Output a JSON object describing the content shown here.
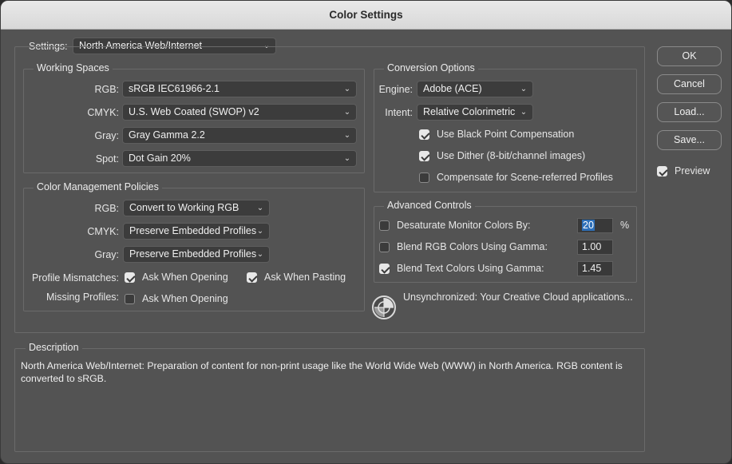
{
  "window": {
    "title": "Color Settings"
  },
  "settings": {
    "label": "Settings:",
    "value": "North America Web/Internet"
  },
  "working_spaces": {
    "title": "Working Spaces",
    "rows": [
      {
        "label": "RGB:",
        "value": "sRGB IEC61966-2.1"
      },
      {
        "label": "CMYK:",
        "value": "U.S. Web Coated (SWOP) v2"
      },
      {
        "label": "Gray:",
        "value": "Gray Gamma 2.2"
      },
      {
        "label": "Spot:",
        "value": "Dot Gain 20%"
      }
    ]
  },
  "policies": {
    "title": "Color Management Policies",
    "rows": [
      {
        "label": "RGB:",
        "value": "Convert to Working RGB"
      },
      {
        "label": "CMYK:",
        "value": "Preserve Embedded Profiles"
      },
      {
        "label": "Gray:",
        "value": "Preserve Embedded Profiles"
      }
    ],
    "mismatches_label": "Profile Mismatches:",
    "ask_opening_label": "Ask When Opening",
    "ask_opening_checked": true,
    "ask_pasting_label": "Ask When Pasting",
    "ask_pasting_checked": true,
    "missing_label": "Missing Profiles:",
    "missing_ask_label": "Ask When Opening",
    "missing_ask_checked": false
  },
  "conversion": {
    "title": "Conversion Options",
    "engine_label": "Engine:",
    "engine_value": "Adobe (ACE)",
    "intent_label": "Intent:",
    "intent_value": "Relative Colorimetric",
    "black_point_label": "Use Black Point Compensation",
    "black_point_checked": true,
    "dither_label": "Use Dither (8-bit/channel images)",
    "dither_checked": true,
    "scene_label": "Compensate for Scene-referred Profiles",
    "scene_checked": false
  },
  "advanced": {
    "title": "Advanced Controls",
    "desaturate_label": "Desaturate Monitor Colors By:",
    "desaturate_checked": false,
    "desaturate_value": "20",
    "desaturate_unit": "%",
    "blend_rgb_label": "Blend RGB Colors Using Gamma:",
    "blend_rgb_checked": false,
    "blend_rgb_value": "1.00",
    "blend_text_label": "Blend Text Colors Using Gamma:",
    "blend_text_checked": true,
    "blend_text_value": "1.45"
  },
  "sync": {
    "icon": "sync-status-icon",
    "text": "Unsynchronized: Your Creative Cloud applications..."
  },
  "description": {
    "title": "Description",
    "text": "North America Web/Internet:  Preparation of content for non-print usage like the World Wide Web (WWW) in North America. RGB content is converted to sRGB."
  },
  "buttons": {
    "ok": "OK",
    "cancel": "Cancel",
    "load": "Load...",
    "save": "Save..."
  },
  "preview": {
    "label": "Preview",
    "checked": true
  },
  "colors": {
    "window_bg": "#535353",
    "titlebar": "#e0e0e0",
    "field_bg": "#3c3c3c",
    "highlight": "#2d6fb8"
  }
}
